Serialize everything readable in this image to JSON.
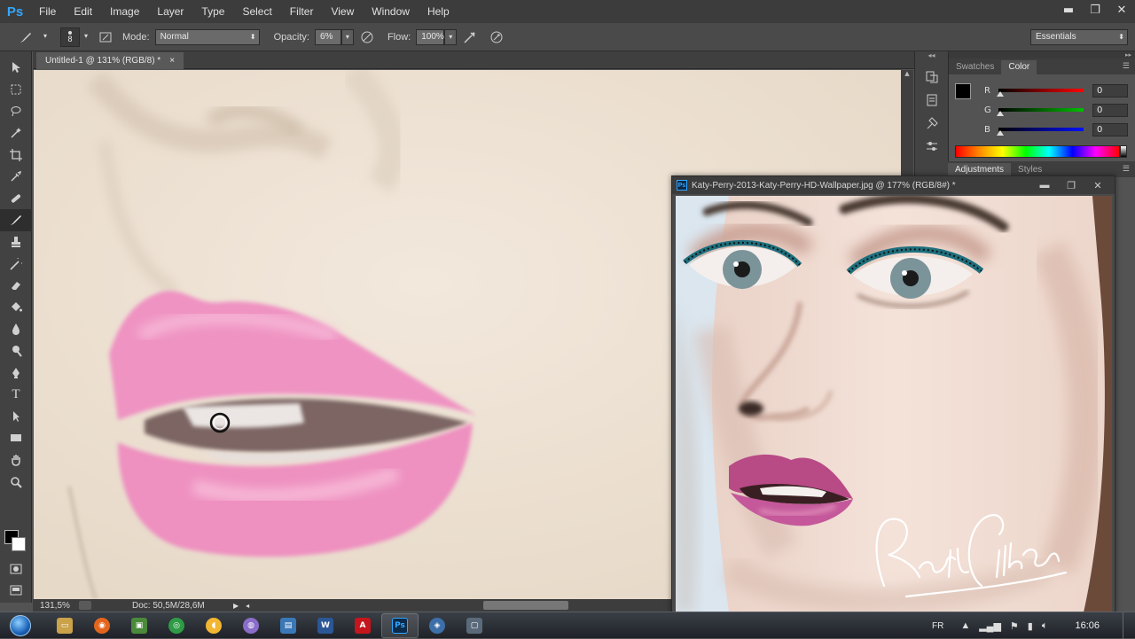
{
  "app": {
    "logo": "Ps",
    "menu": [
      "File",
      "Edit",
      "Image",
      "Layer",
      "Type",
      "Select",
      "Filter",
      "View",
      "Window",
      "Help"
    ],
    "window_controls": {
      "minimize": "▬",
      "restore": "❐",
      "close": "✕"
    }
  },
  "options_bar": {
    "brush_size": "8",
    "mode_label": "Mode:",
    "mode_value": "Normal",
    "opacity_label": "Opacity:",
    "opacity_value": "6%",
    "flow_label": "Flow:",
    "flow_value": "100%",
    "workspace": "Essentials"
  },
  "document": {
    "tab_title": "Untitled-1 @ 131% (RGB/8) *",
    "tab_close": "×",
    "zoom": "131,5%",
    "doc_size": "Doc: 50,5M/28,6M"
  },
  "color_panel": {
    "tabs": [
      "Swatches",
      "Color"
    ],
    "active_tab": "Color",
    "channels": [
      {
        "label": "R",
        "value": "0",
        "color": "#e31b1b"
      },
      {
        "label": "G",
        "value": "0",
        "color": "#1aa81a"
      },
      {
        "label": "B",
        "value": "0",
        "color": "#1b2fd8"
      }
    ],
    "foreground": "#000000",
    "background": "#ffffff"
  },
  "adjust_panel": {
    "tabs": [
      "Adjustments",
      "Styles"
    ],
    "active_tab": "Adjustments"
  },
  "reference_window": {
    "title": "Katy-Perry-2013-Katy-Perry-HD-Wallpaper.jpg @ 177% (RGB/8#) *",
    "ps_badge": "Ps"
  },
  "taskbar": {
    "language": "FR",
    "time": "16:06",
    "apps": [
      {
        "name": "explorer",
        "color": "#c9a24a",
        "glyph": "▭"
      },
      {
        "name": "firefox",
        "color": "#e3651d",
        "glyph": "◉"
      },
      {
        "name": "app-green",
        "color": "#4a8a3a",
        "glyph": "▣"
      },
      {
        "name": "chrome",
        "color": "#2f9b46",
        "glyph": "◎"
      },
      {
        "name": "app-yellow",
        "color": "#f2b632",
        "glyph": "◖"
      },
      {
        "name": "app-purple",
        "color": "#8a6cc9",
        "glyph": "◍"
      },
      {
        "name": "app-blue",
        "color": "#3a78b8",
        "glyph": "▤"
      },
      {
        "name": "word",
        "color": "#2b5797",
        "glyph": "W"
      },
      {
        "name": "acrobat",
        "color": "#c4161c",
        "glyph": "A"
      },
      {
        "name": "photoshop",
        "color": "#0c2a4a",
        "glyph": "Ps"
      },
      {
        "name": "app-network",
        "color": "#3d6fa8",
        "glyph": "◈"
      },
      {
        "name": "app-monitor",
        "color": "#5a6a7a",
        "glyph": "▢"
      }
    ]
  }
}
